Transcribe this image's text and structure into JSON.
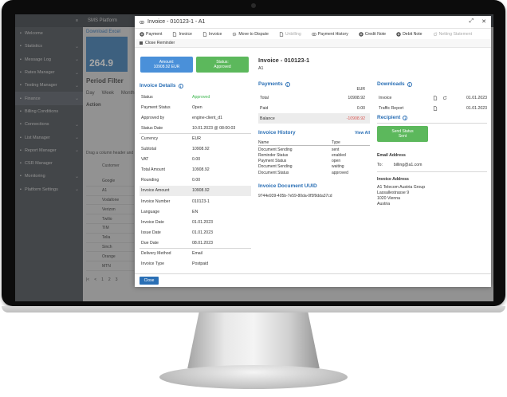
{
  "background_app": {
    "title": "SMS Platform",
    "download_label": "Download Excel",
    "tile_value": "264.9",
    "period_filter": "Period Filter",
    "period_tabs": [
      "Day",
      "Week",
      "Month"
    ],
    "action_label": "Action",
    "drag_hint": "Drag a column header and",
    "customer_header": "Customer",
    "rows": [
      "Google",
      "A1",
      "Vodafone",
      "Verizon",
      "Twilio",
      "TIM",
      "Telia",
      "Sinch",
      "Orange",
      "MTN"
    ],
    "pager": [
      "1",
      "2",
      "3"
    ],
    "sidebar": [
      {
        "label": "Welcome",
        "active": false,
        "chev": false
      },
      {
        "label": "Statistics",
        "active": false,
        "chev": true
      },
      {
        "label": "Message Log",
        "active": false,
        "chev": true
      },
      {
        "label": "Rates Manager",
        "active": false,
        "chev": true
      },
      {
        "label": "Testing Manager",
        "active": false,
        "chev": true
      },
      {
        "label": "Finance",
        "active": true,
        "chev": true
      },
      {
        "label": "Billing Conditions",
        "active": false,
        "chev": false
      },
      {
        "label": "Connections",
        "active": false,
        "chev": true
      },
      {
        "label": "List Manager",
        "active": false,
        "chev": true
      },
      {
        "label": "Report Manager",
        "active": false,
        "chev": true
      },
      {
        "label": "CSR Manager",
        "active": false,
        "chev": false
      },
      {
        "label": "Monitoring",
        "active": false,
        "chev": true
      },
      {
        "label": "Platform Settings",
        "active": false,
        "chev": true
      }
    ]
  },
  "modal": {
    "title": "Invoice - 010123-1 - A1",
    "toolbar": [
      {
        "label": "Payment",
        "icon": "plus-circle-icon",
        "disabled": false
      },
      {
        "label": "Invoice",
        "icon": "document-icon",
        "disabled": false
      },
      {
        "label": "Invoice",
        "icon": "document-icon",
        "disabled": false
      },
      {
        "label": "Move to Dispute",
        "icon": "gear-icon",
        "disabled": false
      },
      {
        "label": "Unbilling",
        "icon": "document-icon",
        "disabled": true
      },
      {
        "label": "Payment History",
        "icon": "eye-icon",
        "disabled": false
      },
      {
        "label": "Credit Note",
        "icon": "plus-circle-icon",
        "disabled": false
      },
      {
        "label": "Debit Note",
        "icon": "plus-circle-icon",
        "disabled": false
      },
      {
        "label": "Netting Statement",
        "icon": "refresh-icon",
        "disabled": true
      }
    ],
    "close_reminder": "Close Reminder",
    "amount_badge": {
      "label": "Amount:",
      "value": "10908.92 EUR"
    },
    "status_badge": {
      "label": "Status:",
      "value": "Approved"
    },
    "heading": "Invoice - 010123-1",
    "sub_heading": "A1",
    "invoice_details_title": "Invoice Details",
    "details": [
      {
        "k": "Status",
        "v": "Approved",
        "green": true
      },
      {
        "k": "Payment Status",
        "v": "Open"
      },
      {
        "k": "Approved by",
        "v": "engine-client_d1"
      },
      {
        "k": "Status Date",
        "v": "10.01.2023 @ 08:00:03"
      },
      {
        "k": "Currency",
        "v": "EUR"
      },
      {
        "k": "Subtotal",
        "v": "10908.92"
      },
      {
        "k": "VAT",
        "v": "0.00"
      },
      {
        "k": "Total Amount",
        "v": "10908.92"
      },
      {
        "k": "Rounding",
        "v": "0.00"
      },
      {
        "k": "Invoice Amount",
        "v": "10908.92",
        "shade": true
      },
      {
        "k": "Invoice Number",
        "v": "010123-1"
      },
      {
        "k": "Language",
        "v": "EN"
      },
      {
        "k": "Invoice Date",
        "v": "01.01.2023"
      },
      {
        "k": "Issue Date",
        "v": "01.01.2023"
      },
      {
        "k": "Due Date",
        "v": "08.01.2023"
      },
      {
        "k": "Delivery Method",
        "v": "Email"
      },
      {
        "k": "Invoice Type",
        "v": "Postpaid"
      }
    ],
    "payments_title": "Payments",
    "payments_currency": "EUR",
    "payments": [
      {
        "k": "Total",
        "v": "10908.92"
      },
      {
        "k": "Paid",
        "v": "0.00"
      },
      {
        "k": "Balance",
        "v": "-10908.92"
      }
    ],
    "history_title": "Invoice History",
    "view_all": "View All",
    "history_headers": [
      "Name",
      "Type"
    ],
    "history": [
      [
        "Document Sending",
        "sent"
      ],
      [
        "Reminder Status",
        "enabled"
      ],
      [
        "Payment Status",
        "open"
      ],
      [
        "Document Sending",
        "waiting"
      ],
      [
        "Document Status",
        "approved"
      ]
    ],
    "uuid_title": "Invoice Document UUID",
    "uuid": "9744e939-405b-7e59-80da-0f5f9dda37cd",
    "downloads_title": "Downloads",
    "downloads": [
      {
        "name": "Invoice",
        "date": "01.01.2023"
      },
      {
        "name": "Traffic Report",
        "date": "01.01.2023"
      }
    ],
    "recipient_title": "Recipient",
    "send_status": {
      "label": "Send Status",
      "value": "Sent"
    },
    "email_address_label": "Email Address",
    "to_label": "To:",
    "email": "billing@a1.com",
    "invoice_address_label": "Invoice Address",
    "address": [
      "A1 Telecom Austria Group",
      "Lassallestrasse 9",
      "1020 Vienna",
      "Austria"
    ],
    "close_button": "Close"
  },
  "colors": {
    "accent": "#2a6fb5",
    "green": "#5cb85c",
    "blue_badge": "#4a90d9",
    "negative": "#d9534f"
  }
}
